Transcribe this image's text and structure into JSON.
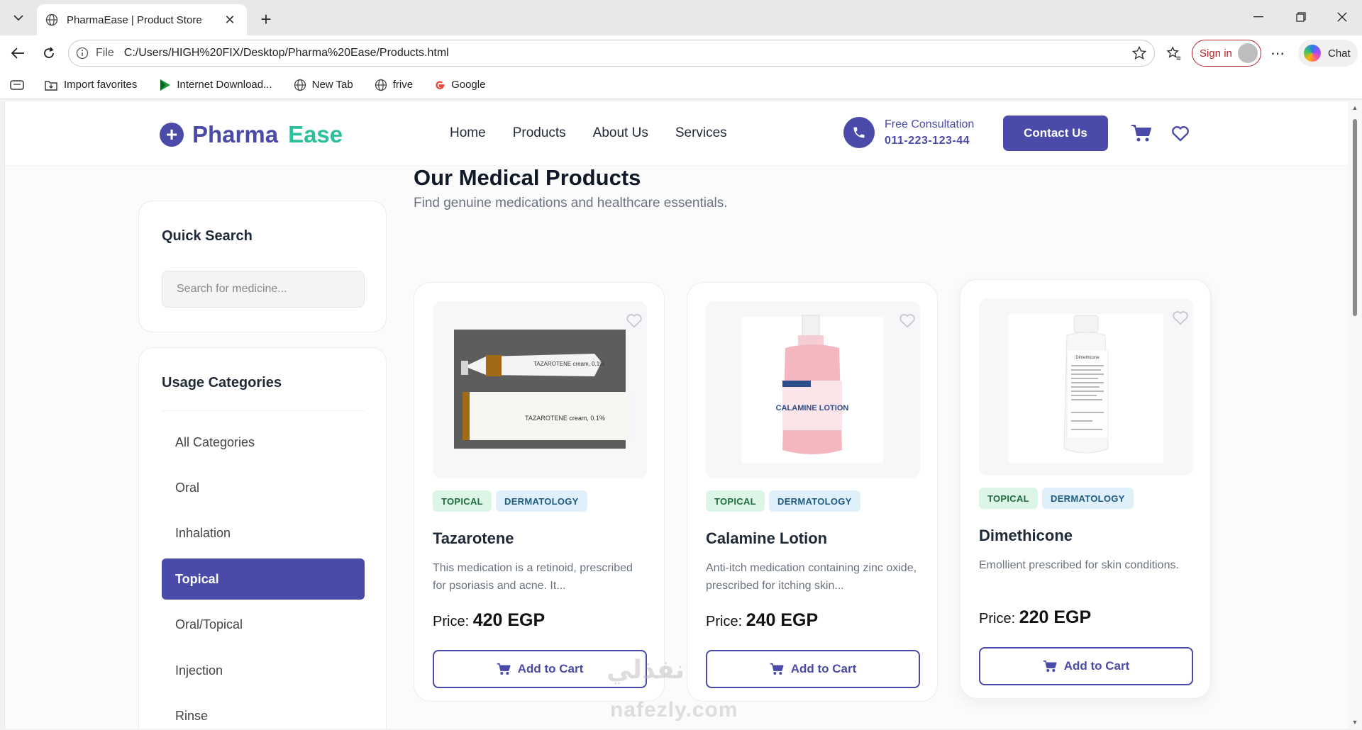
{
  "browser": {
    "tab_title": "PharmaEase | Product Store",
    "tab_close": "✕",
    "new_tab": "+",
    "file_label": "File",
    "url": "C:/Users/HIGH%20FIX/Desktop/Pharma%20Ease/Products.html",
    "signin_label": "Sign in",
    "chat_label": "Chat",
    "favorites": [
      "Import favorites",
      "Internet Download...",
      "New Tab",
      "frive",
      "Google"
    ]
  },
  "site": {
    "logo_part1": "Pharma",
    "logo_part2": "Ease",
    "nav": [
      "Home",
      "Products",
      "About Us",
      "Services"
    ],
    "consult_label": "Free Consultation",
    "consult_phone": "011-223-123-44",
    "contact_label": "Contact Us"
  },
  "sidebar": {
    "search_title": "Quick Search",
    "search_placeholder": "Search for medicine...",
    "categories_title": "Usage Categories",
    "categories": [
      "All Categories",
      "Oral",
      "Inhalation",
      "Topical",
      "Oral/Topical",
      "Injection",
      "Rinse"
    ],
    "active_category": "Topical"
  },
  "main": {
    "heading": "Our Medical Products",
    "subheading": "Find genuine medications and healthcare essentials.",
    "price_label": "Price:",
    "cart_label": "Add to Cart",
    "products": [
      {
        "name": "Tazarotene",
        "tags": [
          "TOPICAL",
          "DERMATOLOGY"
        ],
        "desc": "This medication is a retinoid, prescribed for psoriasis and acne. It...",
        "price": "420 EGP",
        "box_text": "TAZAROTENE cream, 0.1%"
      },
      {
        "name": "Calamine Lotion",
        "tags": [
          "TOPICAL",
          "DERMATOLOGY"
        ],
        "desc": "Anti-itch medication containing zinc oxide, prescribed for itching skin...",
        "price": "240 EGP",
        "box_text": "CALAMINE LOTION"
      },
      {
        "name": "Dimethicone",
        "tags": [
          "TOPICAL",
          "DERMATOLOGY"
        ],
        "desc": "Emollient prescribed for skin conditions.",
        "price": "220 EGP",
        "box_text": "Dimethicone"
      }
    ]
  },
  "watermark": {
    "arabic": "نفذلي",
    "latin": "nafezly.com"
  },
  "colors": {
    "brand": "#4a4aa8",
    "accent": "#2bbf9e"
  }
}
